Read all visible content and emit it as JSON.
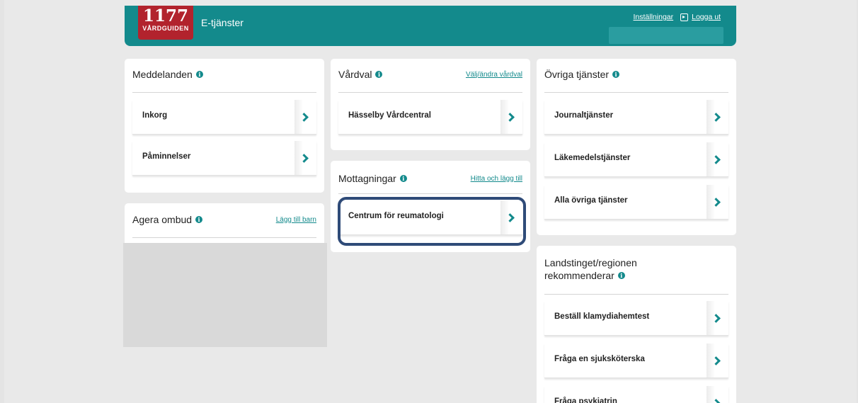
{
  "header": {
    "logo_number": "1177",
    "logo_sub": "VÅRDGUIDEN",
    "service_title": "E-tjänster",
    "settings_link": "Inställningar",
    "logout_link": "Logga ut"
  },
  "messages": {
    "title": "Meddelanden",
    "items": [
      {
        "label": "Inkorg"
      },
      {
        "label": "Påminnelser"
      }
    ]
  },
  "proxy": {
    "title": "Agera ombud",
    "link": "Lägg till barn"
  },
  "care_choice": {
    "title": "Vårdval",
    "link": "Välj/ändra vårdval",
    "items": [
      {
        "label": "Hässelby Vårdcentral"
      }
    ]
  },
  "clinics": {
    "title": "Mottagningar",
    "link": "Hitta och lägg till",
    "items": [
      {
        "label": "Centrum för reumatologi"
      }
    ]
  },
  "other_services": {
    "title": "Övriga tjänster",
    "items": [
      {
        "label": "Journaltjänster"
      },
      {
        "label": "Läkemedelstjänster"
      },
      {
        "label": "Alla övriga tjänster"
      }
    ]
  },
  "recommends": {
    "title_line1": "Landstinget/regionen",
    "title_line2": "rekommenderar",
    "items": [
      {
        "label": "Beställ klamydiahemtest"
      },
      {
        "label": "Fråga en sjuksköterska"
      },
      {
        "label": "Fråga psykiatrin"
      }
    ]
  },
  "colors": {
    "brand": "#138a8c",
    "logo": "#b2232d",
    "highlight": "#2f4b78"
  }
}
